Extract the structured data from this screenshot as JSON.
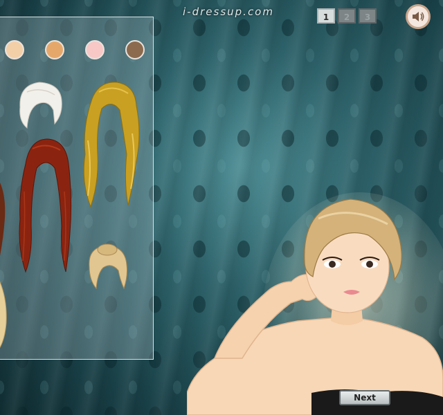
{
  "header": {
    "site_logo": "i-dressup.com"
  },
  "page_tabs": [
    {
      "label": "1",
      "active": true
    },
    {
      "label": "2",
      "active": false
    },
    {
      "label": "3",
      "active": false
    }
  ],
  "sound": {
    "icon": "speaker-icon"
  },
  "panel": {
    "skin_tones": [
      "#f3cfa8",
      "#e6a86a",
      "#f7c8c6",
      "#8c6a4e"
    ],
    "hair_items": [
      {
        "name": "short-white-bob",
        "color": "#f2f0ea"
      },
      {
        "name": "long-golden-wavy",
        "color": "#c9a021"
      },
      {
        "name": "long-red-straight",
        "color": "#8a2410"
      },
      {
        "name": "blonde-updo",
        "color": "#e2c691"
      }
    ]
  },
  "next_button": {
    "label": "Next"
  }
}
